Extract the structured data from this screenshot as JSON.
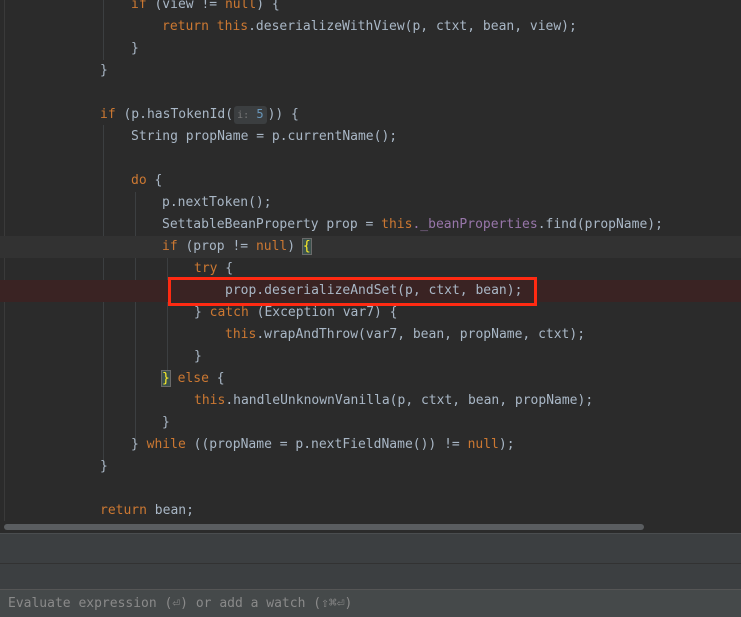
{
  "colors": {
    "background": "#2b2b2b",
    "keyword": "#cc7832",
    "text": "#a9b7c6",
    "field": "#9876aa",
    "number": "#6897bb",
    "highlight_box": "#ff2a12"
  },
  "editor": {
    "lines": {
      "l1": {
        "kw_if": "if",
        "a": " (view != ",
        "kw_null": "null",
        "b": ") {"
      },
      "l2": {
        "kw_return": "return",
        "sp": " ",
        "kw_this": "this",
        "b": ".deserializeWithView(p, ctxt, bean, view);"
      },
      "l3": {
        "text": "}"
      },
      "l4": {
        "text": "}"
      },
      "l5": {
        "kw_if": "if",
        "a": " (p.hasTokenId(",
        "hint_label": "i:",
        "hint_value": "5",
        "b": ")) {"
      },
      "l6": {
        "text": "String propName = p.currentName();"
      },
      "l7": {
        "kw_do": "do",
        "b": " {"
      },
      "l8": {
        "text": "p.nextToken();"
      },
      "l9": {
        "a": "SettableBeanProperty prop = ",
        "kw_this": "this",
        "field": "._beanProperties",
        "b": ".find(propName);"
      },
      "l10": {
        "kw_if": "if",
        "a": " (prop != ",
        "kw_null": "null",
        "b": ") ",
        "brace": "{"
      },
      "l11": {
        "kw_try": "try",
        "b": " {"
      },
      "l12": {
        "text": "prop.deserializeAndSet(p, ctxt, bean);"
      },
      "l13": {
        "a": "} ",
        "kw_catch": "catch",
        "b": " (Exception var7) {"
      },
      "l14": {
        "kw_this": "this",
        "b": ".wrapAndThrow(var7, bean, propName, ctxt);"
      },
      "l15": {
        "text": "}"
      },
      "l16": {
        "brace": "}",
        "sp": " ",
        "kw_else": "else",
        "b": " {"
      },
      "l17": {
        "kw_this": "this",
        "b": ".handleUnknownVanilla(p, ctxt, bean, propName);"
      },
      "l18": {
        "text": "}"
      },
      "l19": {
        "a": "} ",
        "kw_while": "while",
        "b": " ((propName = p.nextFieldName()) != ",
        "kw_null": "null",
        "c": ");"
      },
      "l20": {
        "text": "}"
      },
      "l21": {
        "kw_return": "return",
        "b": " bean;"
      }
    }
  },
  "evaluate": {
    "placeholder": "Evaluate expression (⏎) or add a watch (⇧⌘⏎)"
  }
}
